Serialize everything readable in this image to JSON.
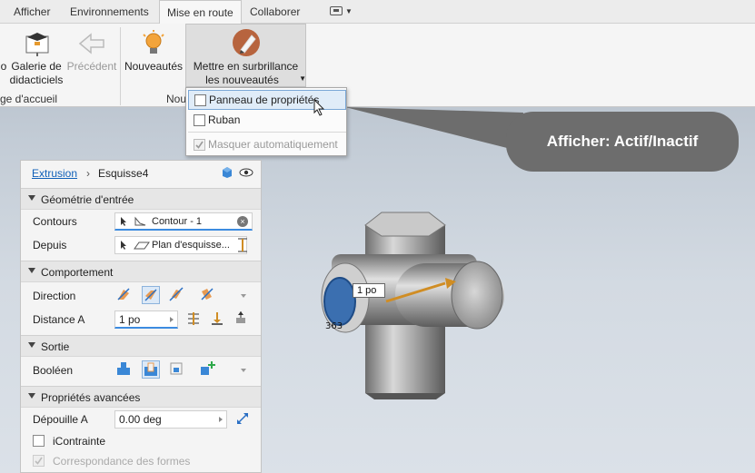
{
  "tabs": [
    "Afficher",
    "Environnements",
    "Mise en route",
    "Collaborer"
  ],
  "ribbon": {
    "partial_left": "o",
    "galerie_label_1": "Galerie de",
    "galerie_label_2": "didacticiels",
    "precedent_label": "Précédent",
    "nouveautes_label": "Nouveautés",
    "highlight_label_1": "Mettre en surbrillance",
    "highlight_label_2": "les nouveautés",
    "panel_accueil": "ge d'accueil",
    "panel_nou": "Nou"
  },
  "dropdown": {
    "items": [
      {
        "label": "Panneau de propriétés",
        "checked": false
      },
      {
        "label": "Ruban",
        "checked": false
      },
      {
        "label": "Masquer automatiquement",
        "checked": true,
        "disabled": true
      }
    ]
  },
  "callout": {
    "text": "Afficher: Actif/Inactif"
  },
  "panel": {
    "crumb_feature": "Extrusion",
    "crumb_sketch": "Esquisse4",
    "sections": {
      "input_geometry": "Géométrie d'entrée",
      "behavior": "Comportement",
      "output": "Sortie",
      "advanced": "Propriétés avancées"
    },
    "profiles_label": "Contours",
    "profiles_value": "Contour - 1",
    "from_label": "Depuis",
    "from_value": "Plan d'esquisse...",
    "direction_label": "Direction",
    "distance_label": "Distance A",
    "distance_value": "1 po",
    "boolean_label": "Booléen",
    "taper_label": "Dépouille A",
    "taper_value": "0.00 deg",
    "iconstraint_label": "iContrainte",
    "match_shape_label": "Correspondance des formes"
  },
  "model": {
    "dimension": "1 po",
    "face_label": "363"
  },
  "colors": {
    "accent": "#3c8be0",
    "link": "#1060b8",
    "callout": "#6d6d6d"
  }
}
